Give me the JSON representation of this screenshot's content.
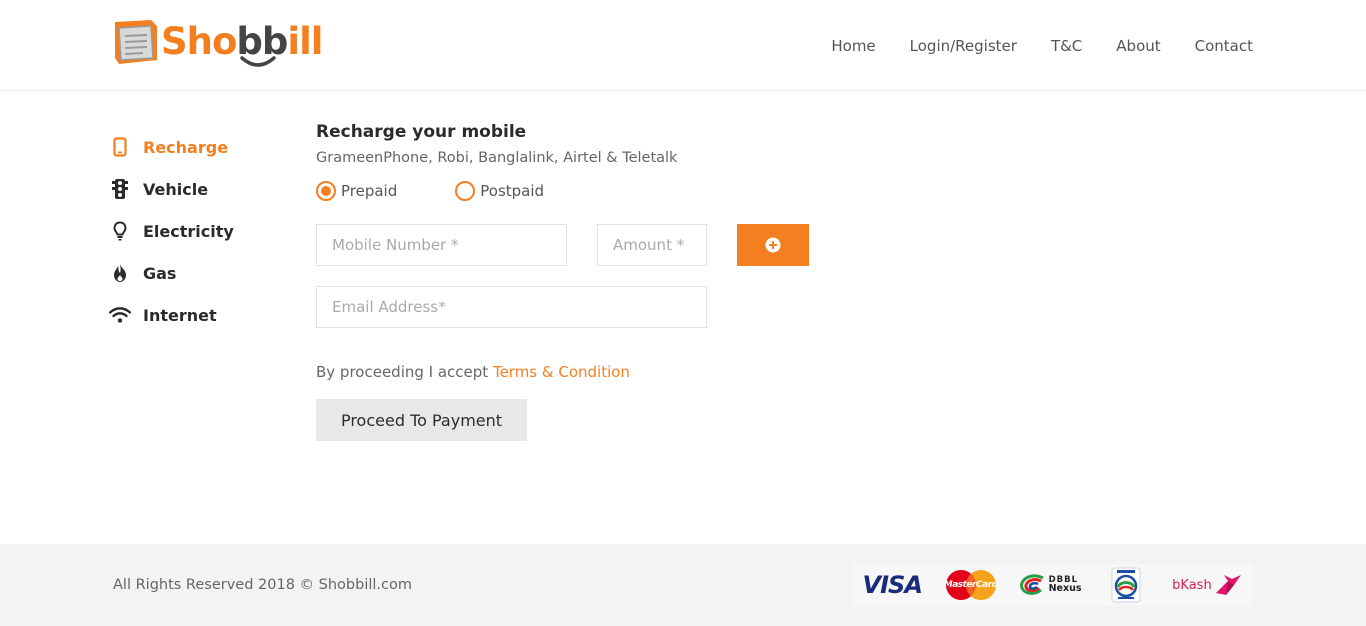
{
  "brand": {
    "logo_name": "Shobbill",
    "logo_part1": "Sho",
    "logo_part2": "bb",
    "logo_part3": "ill",
    "accent_color": "#f47f20"
  },
  "nav": {
    "items": [
      {
        "label": "Home"
      },
      {
        "label": "Login/Register"
      },
      {
        "label": "T&C"
      },
      {
        "label": "About"
      },
      {
        "label": "Contact"
      }
    ]
  },
  "sidebar": {
    "items": [
      {
        "label": "Recharge",
        "icon": "mobile-phone-icon",
        "active": true
      },
      {
        "label": "Vehicle",
        "icon": "traffic-light-icon",
        "active": false
      },
      {
        "label": "Electricity",
        "icon": "lightbulb-icon",
        "active": false
      },
      {
        "label": "Gas",
        "icon": "flame-icon",
        "active": false
      },
      {
        "label": "Internet",
        "icon": "wifi-icon",
        "active": false
      }
    ]
  },
  "form": {
    "title": "Recharge your mobile",
    "subtitle": "GrameenPhone, Robi, Banglalink, Airtel & Teletalk",
    "radio_prepaid": "Prepaid",
    "radio_postpaid": "Postpaid",
    "selected_plan": "Prepaid",
    "mobile_placeholder": "Mobile Number *",
    "amount_placeholder": "Amount *",
    "email_placeholder": "Email Address*",
    "terms_prefix": "By proceeding I accept",
    "terms_link": "Terms & Condition",
    "proceed_label": "Proceed To Payment",
    "add_icon": "plus-circle-icon"
  },
  "footer": {
    "copyright": "All Rights Reserved 2018 © Shobbill.com",
    "payment_methods": [
      {
        "label": "VISA"
      },
      {
        "label": "MasterCard"
      },
      {
        "label": "DBBL",
        "label2": "Nexus"
      },
      {
        "label": ""
      },
      {
        "label": "bKash"
      }
    ]
  }
}
